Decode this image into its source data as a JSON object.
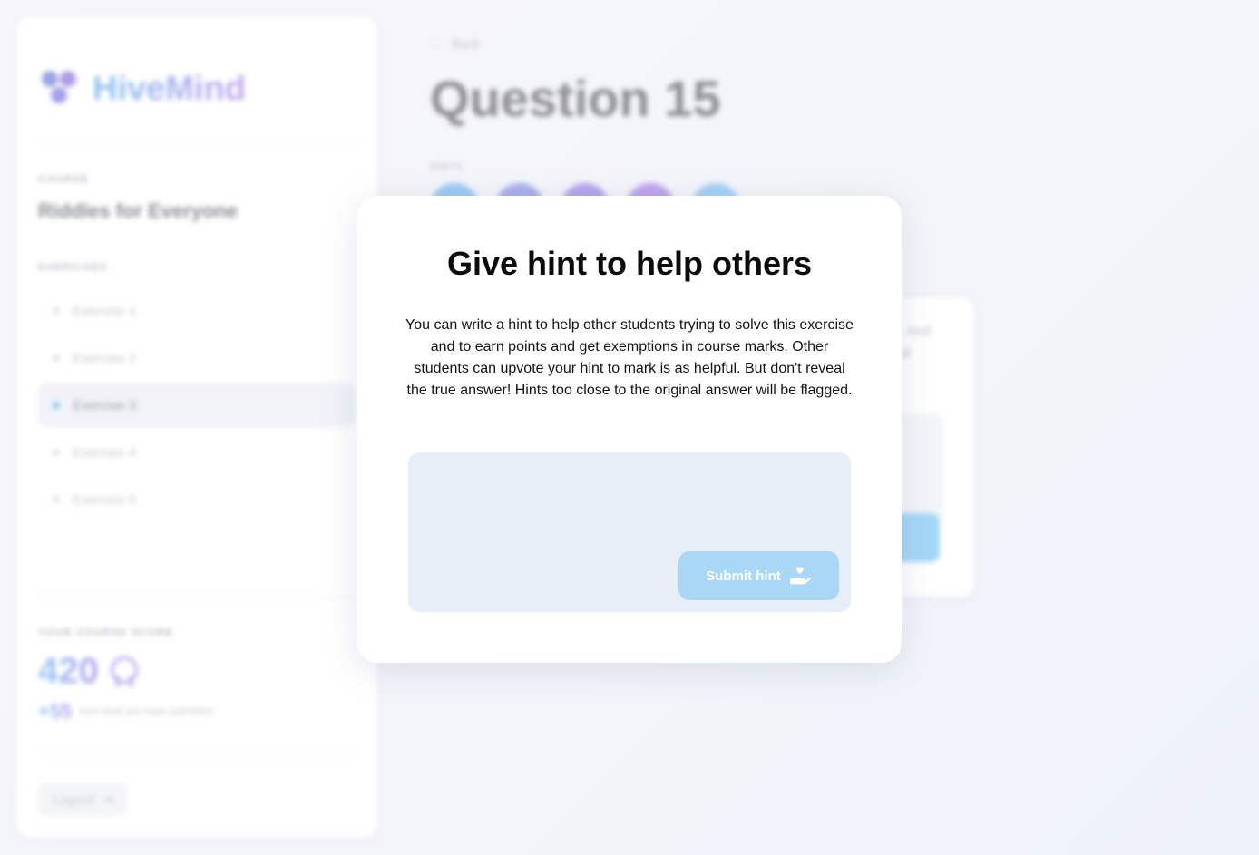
{
  "app": {
    "brand": "HiveMind"
  },
  "sidebar": {
    "course_label": "COURSE",
    "course_name": "Riddles for Everyone",
    "exercises_label": "EXERCISES",
    "exercises": [
      {
        "label": "Exercise 1",
        "active": false
      },
      {
        "label": "Exercise 2",
        "active": false
      },
      {
        "label": "Exercise 3",
        "active": true
      },
      {
        "label": "Exercise 4",
        "active": false
      },
      {
        "label": "Exercise 5",
        "active": false
      }
    ],
    "score_label": "YOUR COURSE SCORE",
    "score": "420",
    "bonus": "+55",
    "bonus_text": "from hints you have submitted",
    "logout_label": "Logout"
  },
  "main": {
    "back_label": "Back",
    "question_title": "Question 15",
    "hints_label": "HINTS",
    "hint_card_text": "it. And\nrial"
  },
  "modal": {
    "title": "Give hint to help others",
    "description": "You can write a hint to help other students trying to solve this exercise and to earn points and get exemptions in course marks. Other students can upvote your hint to mark is as helpful. But don't reveal the true answer! Hints too close to the original answer will be flagged.",
    "input_value": "",
    "input_placeholder": "",
    "submit_label": "Submit hint",
    "submit_icon": "hand-heart-icon"
  },
  "colors": {
    "accent": "#a9d7f6",
    "input_bg": "#e8eef7",
    "brand_from": "#8cc4f4",
    "brand_to": "#c4a6ec",
    "hint_avatars": [
      "#9ccaf4",
      "#a9b0ec",
      "#b6a6ec",
      "#c1a4ec",
      "#a4d2f6"
    ]
  }
}
